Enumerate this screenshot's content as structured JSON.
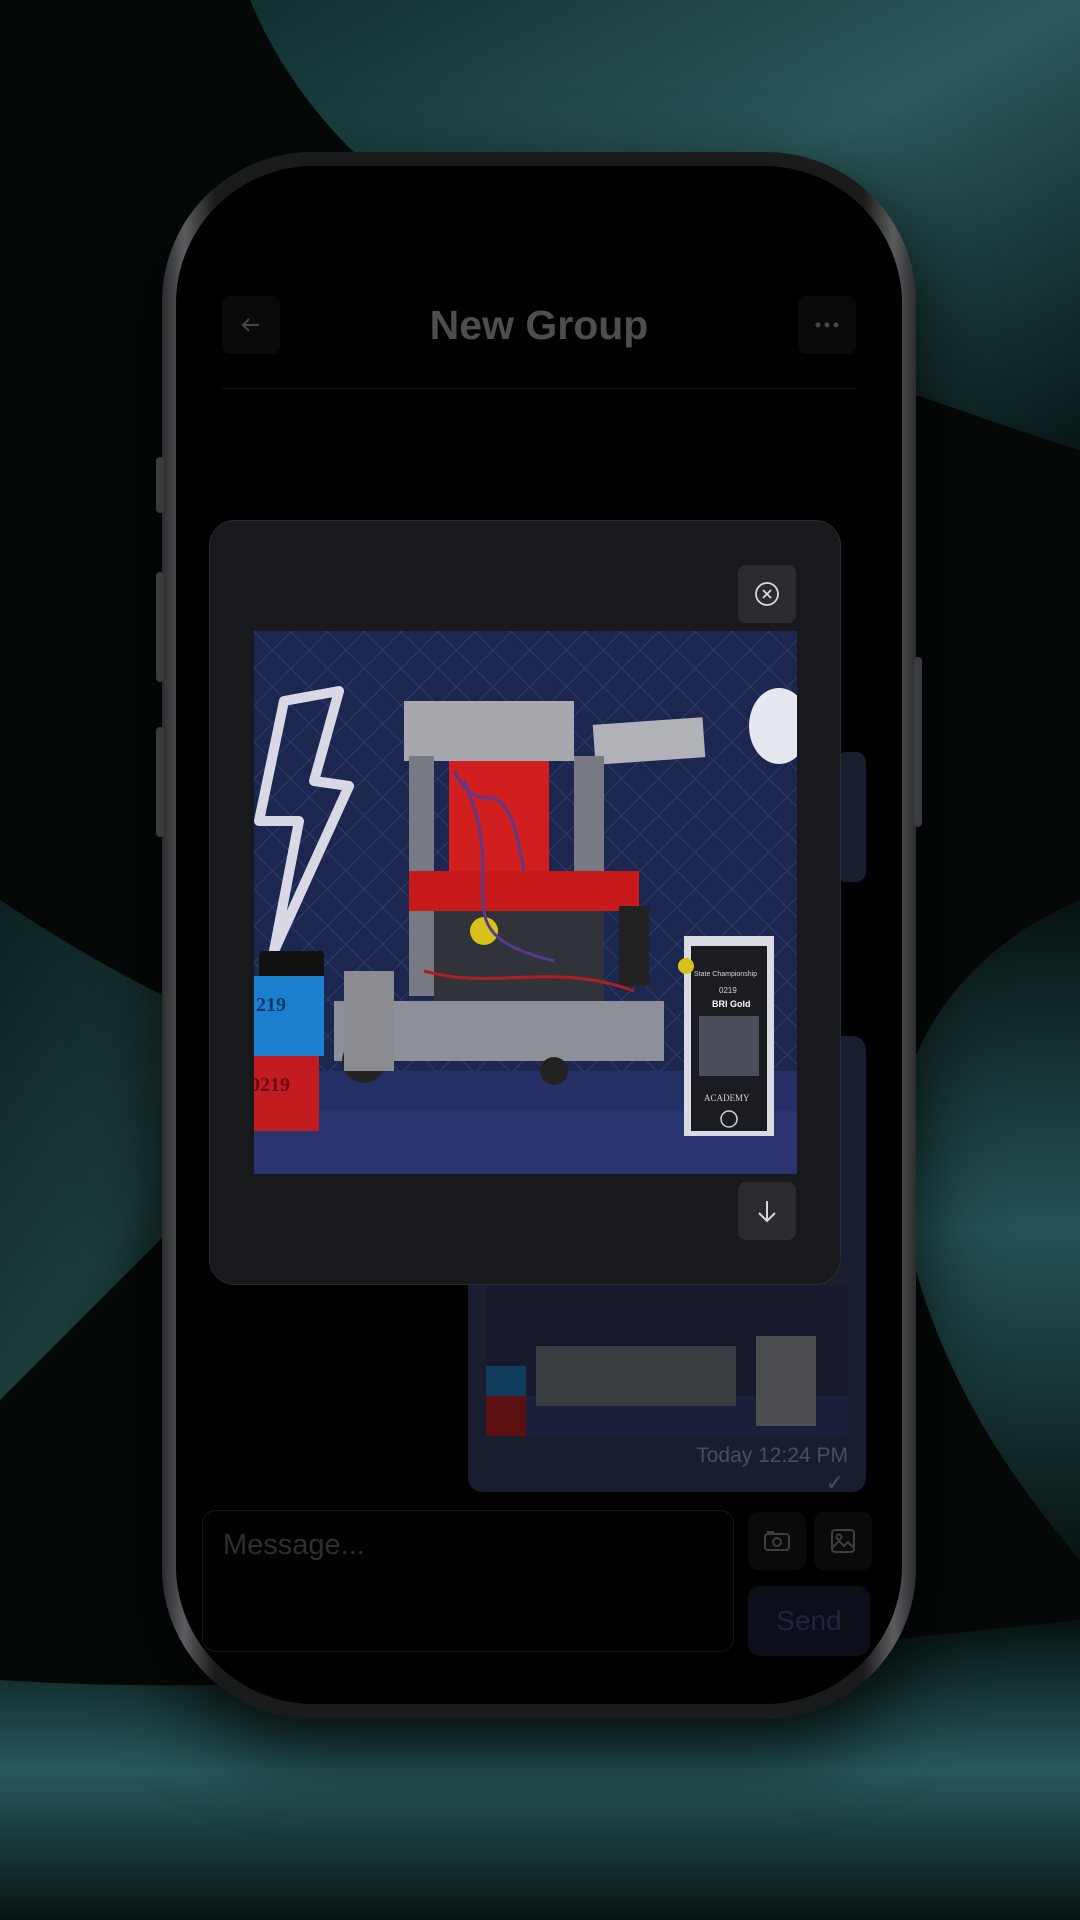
{
  "header": {
    "title": "New Group",
    "back_icon": "arrow-left-icon",
    "menu_icon": "more-horizontal-icon"
  },
  "message": {
    "timestamp": "Today 12:24 PM",
    "status_check": "✓"
  },
  "composer": {
    "placeholder": "Message...",
    "send_label": "Send",
    "camera_icon": "camera-icon",
    "gallery_icon": "image-icon"
  },
  "viewer": {
    "close_icon": "close-circle-icon",
    "download_icon": "arrow-down-icon",
    "photo_labels": {
      "team_number_1": "219",
      "team_number_2": "0219",
      "award_title": "State Championship",
      "award_team": "0219",
      "award_name": "BRI Gold",
      "award_org": "ACADEMY"
    }
  },
  "colors": {
    "accent": "#2c3558",
    "background": "#000000",
    "modal": "#18191d"
  }
}
